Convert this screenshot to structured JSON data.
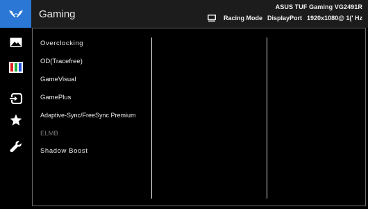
{
  "header": {
    "title": "Gaming",
    "model": "ASUS TUF Gaming  VG2491R",
    "mode": "Racing Mode",
    "input": "DisplayPort",
    "resolution": "1920x1080@ 1(' Hz"
  },
  "sidebar": {
    "items": [
      {
        "icon": "tuf-logo-icon"
      },
      {
        "icon": "image-icon"
      },
      {
        "icon": "color-bars-icon"
      },
      {
        "icon": "input-select-icon"
      },
      {
        "icon": "star-icon"
      },
      {
        "icon": "wrench-icon"
      }
    ]
  },
  "menu": {
    "items": [
      {
        "label": "Overclocking",
        "enabled": true
      },
      {
        "label": "OD(Tracefree)",
        "enabled": true
      },
      {
        "label": "GameVisual",
        "enabled": true
      },
      {
        "label": "GamePlus",
        "enabled": true
      },
      {
        "label": "Adaptive-Sync/FreeSync Premium",
        "enabled": true
      },
      {
        "label": "ELMB",
        "enabled": false
      },
      {
        "label": "Shadow Boost",
        "enabled": true
      }
    ]
  },
  "colors": {
    "accent": "#2a77d6",
    "background": "#000000",
    "header": "#1c1c1c",
    "text": "#eeeeee",
    "disabled_text": "#7b7b7b"
  }
}
